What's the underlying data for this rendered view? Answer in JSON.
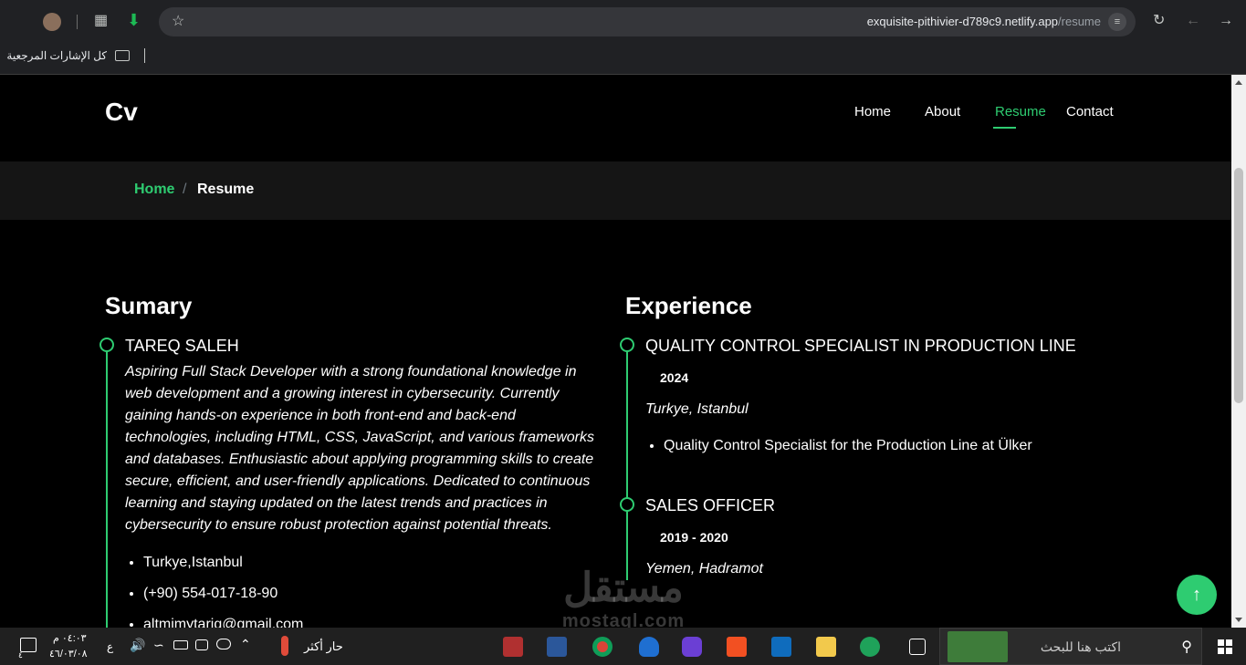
{
  "browser": {
    "url_host": "exquisite-pithivier-d789c9.netlify.app",
    "url_path": "/resume",
    "bookmarks_label": "كل الإشارات المرجعية"
  },
  "header": {
    "logo": "Cv",
    "nav": [
      {
        "label": "Home",
        "active": false
      },
      {
        "label": "About",
        "active": false
      },
      {
        "label": "Resume",
        "active": true
      },
      {
        "label": "Contact",
        "active": false
      }
    ]
  },
  "breadcrumb": {
    "home": "Home",
    "separator": "/",
    "current": "Resume"
  },
  "summary": {
    "title": "Sumary",
    "name": "TAREQ SALEH",
    "text": "Aspiring Full Stack Developer with a strong foundational knowledge in web development and a growing interest in cybersecurity. Currently gaining hands-on experience in both front-end and back-end technologies, including HTML, CSS, JavaScript, and various frameworks and databases. Enthusiastic about applying programming skills to create secure, efficient, and user-friendly applications. Dedicated to continuous learning and staying updated on the latest trends and practices in cybersecurity to ensure robust protection against potential threats.",
    "contacts": [
      "Turkye,Istanbul",
      "(+90) 554-017-18-90",
      "altmimytariq@gmail.com"
    ]
  },
  "experience": {
    "title": "Experience",
    "items": [
      {
        "title": "QUALITY CONTROL SPECIALIST IN PRODUCTION LINE",
        "years": "2024",
        "location": "Turkye, Istanbul",
        "bullets": [
          "Quality Control Specialist for the Production Line at Ülker"
        ]
      },
      {
        "title": "SALES OFFICER",
        "years": "2019 - 2020",
        "location": "Yemen, Hadramot"
      }
    ]
  },
  "watermark": {
    "arabic": "مستقل",
    "latin": "mostaql.com"
  },
  "taskbar": {
    "search_placeholder": "اكتب هنا للبحث",
    "weather": "حار أكثر",
    "time": "٠٤:٠٣ م",
    "date": "٤٦/٠٣/٠٨",
    "lang": "ع",
    "notif_badge": "٤"
  },
  "colors": {
    "accent": "#2ecc71",
    "background": "#000000",
    "breadcrumb_bg": "#151515"
  }
}
